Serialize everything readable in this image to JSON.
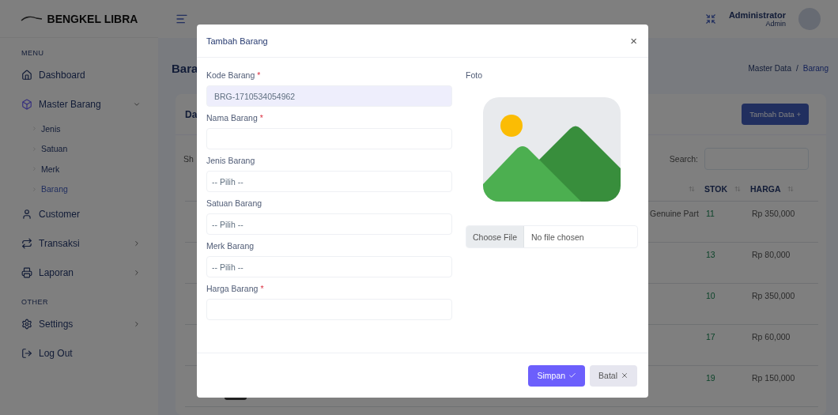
{
  "sidebar": {
    "brand": "BENGKEL LIBRA",
    "sections": [
      {
        "label": "MENU",
        "items": [
          {
            "label": "Dashboard",
            "selected": false
          },
          {
            "label": "Master Barang",
            "selected": true,
            "expanded": true,
            "children": [
              {
                "label": "Jenis",
                "selected": false
              },
              {
                "label": "Satuan",
                "selected": false
              },
              {
                "label": "Merk",
                "selected": false
              },
              {
                "label": "Barang",
                "selected": true
              }
            ]
          },
          {
            "label": "Customer",
            "selected": false
          },
          {
            "label": "Transaksi",
            "selected": false,
            "expanded": false
          },
          {
            "label": "Laporan",
            "selected": false,
            "expanded": false
          }
        ]
      },
      {
        "label": "OTHER",
        "items": [
          {
            "label": "Settings",
            "selected": false,
            "expanded": false
          },
          {
            "label": "Log Out",
            "selected": false
          }
        ]
      }
    ]
  },
  "topbar": {
    "user_name": "Administrator",
    "user_role": "Admin"
  },
  "page": {
    "title": "Bara",
    "breadcrumb": [
      {
        "label": "Master Data",
        "selected": false
      },
      {
        "separator": "/",
        "label": "Barang",
        "selected": true
      }
    ],
    "card": {
      "title": "Da",
      "add_button": "Tambah Data +",
      "show_label": "Sh",
      "search_label": "Search:",
      "table": {
        "columns": [
          "STOK",
          "HARGA"
        ],
        "rows": [
          {
            "column_1": "Genuine Part",
            "stok": "11",
            "harga": "Rp 350,000"
          },
          {
            "stok": "13",
            "harga": "Rp 80,000"
          },
          {
            "stok": "10",
            "harga": "Rp 350,000"
          },
          {
            "stok": "17",
            "harga": "Rp 60,000"
          },
          {
            "stok": "19",
            "harga": "Rp 150,000"
          }
        ]
      }
    }
  },
  "modal": {
    "title": "Tambah Barang",
    "close": "×",
    "fields": [
      {
        "kind": "text",
        "label": "Kode Barang",
        "required_mark": "*",
        "readonly": true,
        "value": "BRG-1710534054962"
      },
      {
        "kind": "text",
        "label": "Nama Barang",
        "required_mark": "*",
        "readonly": false
      },
      {
        "kind": "select",
        "label": "Jenis Barang",
        "value": "-- Pilih --"
      },
      {
        "kind": "select",
        "label": "Satuan Barang",
        "value": "-- Pilih --"
      },
      {
        "kind": "select",
        "label": "Merk Barang",
        "value": "-- Pilih --"
      },
      {
        "kind": "text",
        "label": "Harga Barang",
        "required_mark": "*",
        "readonly": false
      }
    ],
    "photo": {
      "label": "Foto",
      "file_button": "Choose File",
      "file_status": "No file chosen"
    },
    "buttons": [
      {
        "kind": "primary",
        "label": "Simpan"
      },
      {
        "kind": "secondary",
        "label": "Batal"
      }
    ]
  }
}
